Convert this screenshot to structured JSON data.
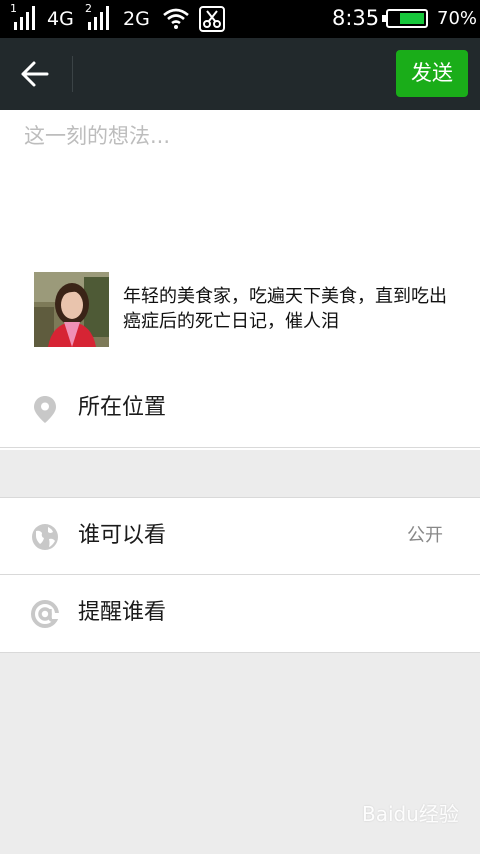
{
  "status_bar": {
    "sim1_label": "1",
    "sim1_network": "4G",
    "sim2_label": "2",
    "sim2_network": "2G",
    "time": "8:35",
    "battery_percent": "70%",
    "battery_level": 0.7,
    "icons": [
      "signal-icon",
      "wifi-icon",
      "scissors-icon",
      "battery-icon"
    ]
  },
  "header": {
    "back_icon": "back-arrow-icon",
    "send_label": "发送",
    "send_color": "#1aad19"
  },
  "compose": {
    "placeholder": "这一刻的想法..."
  },
  "shared_link": {
    "title": "年轻的美食家，吃遍天下美食，直到吃出癌症后的死亡日记，催人泪"
  },
  "options": {
    "location_label": "所在位置",
    "visibility_label": "谁可以看",
    "visibility_value": "公开",
    "remind_label": "提醒谁看"
  },
  "watermark": {
    "text": "Baidu经验"
  }
}
